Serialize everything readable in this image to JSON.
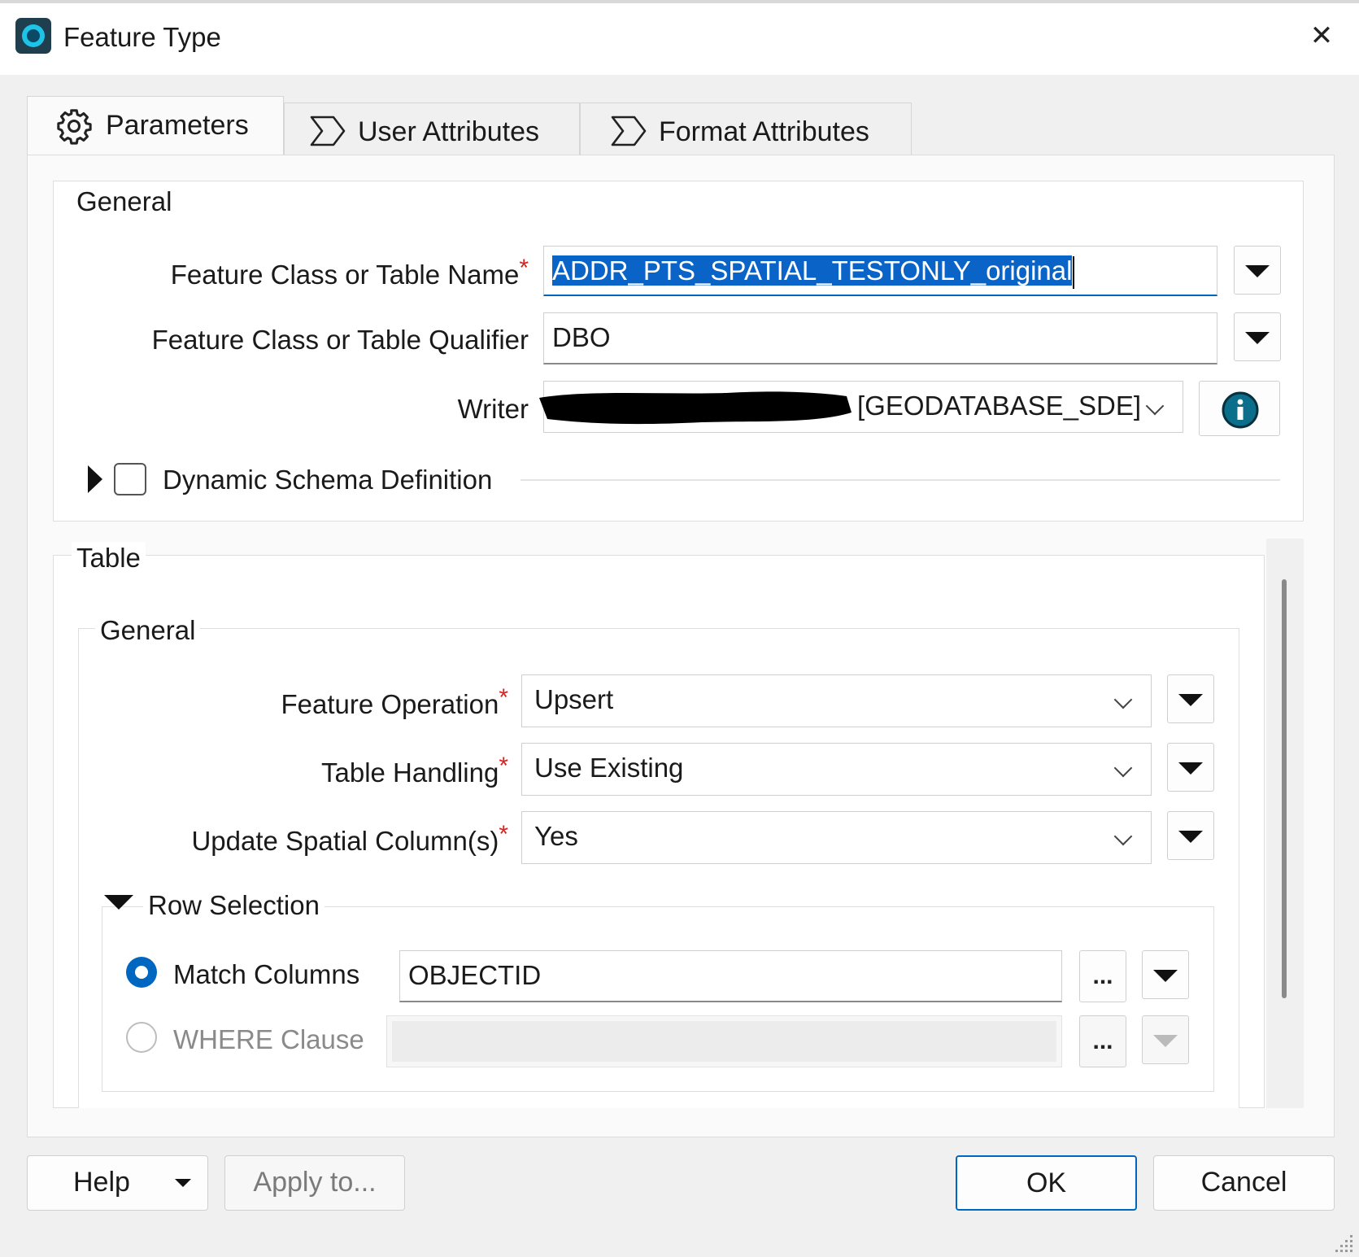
{
  "window": {
    "title": "Feature Type",
    "close_glyph": "✕"
  },
  "tabs": [
    {
      "label": "Parameters",
      "icon": "gear-icon",
      "active": true
    },
    {
      "label": "User Attributes",
      "icon": "sigma-icon",
      "active": false
    },
    {
      "label": "Format Attributes",
      "icon": "sigma-icon",
      "active": false
    }
  ],
  "general": {
    "title": "General",
    "feature_class_name": {
      "label": "Feature Class or Table Name",
      "value": "ADDR_PTS_SPATIAL_TESTONLY_original",
      "required": true
    },
    "qualifier": {
      "label": "Feature Class or Table Qualifier",
      "value": "DBO"
    },
    "writer": {
      "label": "Writer",
      "value": "[GEODATABASE_SDE]"
    },
    "dynamic_schema": {
      "label": "Dynamic Schema Definition",
      "checked": false
    }
  },
  "table": {
    "title": "Table",
    "general": {
      "title": "General",
      "feature_operation": {
        "label": "Feature Operation",
        "value": "Upsert"
      },
      "table_handling": {
        "label": "Table Handling",
        "value": "Use Existing"
      },
      "update_spatial": {
        "label": "Update Spatial Column(s)",
        "value": "Yes"
      }
    },
    "row_selection": {
      "title": "Row Selection",
      "match_columns": {
        "label": "Match Columns",
        "value": "OBJECTID",
        "selected": true
      },
      "where_clause": {
        "label": "WHERE Clause",
        "value": "",
        "selected": false
      }
    }
  },
  "common": {
    "required_mark": "*",
    "ellipsis": "..."
  },
  "footer": {
    "help": "Help",
    "apply": "Apply to...",
    "ok": "OK",
    "cancel": "Cancel"
  },
  "colors": {
    "accent": "#0067c0",
    "selection": "#0a64c8",
    "required": "#d9231d",
    "info": "#0b6e8a"
  }
}
